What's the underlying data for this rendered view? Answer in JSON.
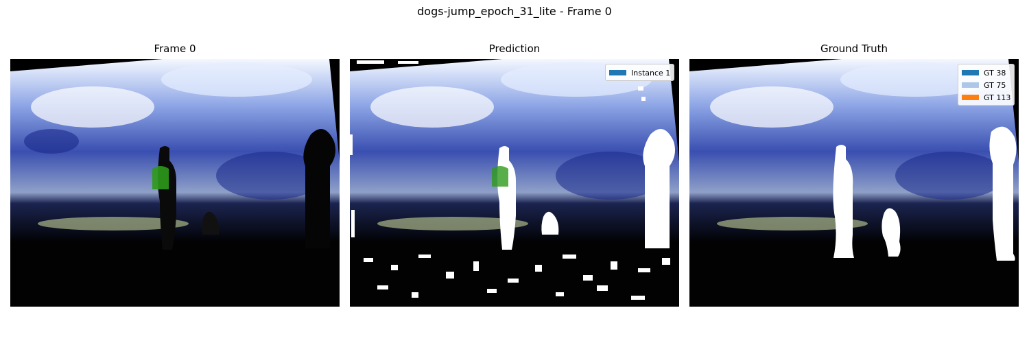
{
  "figure": {
    "suptitle": "dogs-jump_epoch_31_lite - Frame 0"
  },
  "panels": [
    {
      "title": "Frame 0"
    },
    {
      "title": "Prediction"
    },
    {
      "title": "Ground Truth"
    }
  ],
  "prediction_legend": [
    {
      "label": "Instance 1",
      "color": "#1f77b4"
    }
  ],
  "ground_truth_legend": [
    {
      "label": "GT 38",
      "color": "#1f77b4"
    },
    {
      "label": "GT 75",
      "color": "#aec7e8"
    },
    {
      "label": "GT 113",
      "color": "#ff7f0e"
    }
  ]
}
